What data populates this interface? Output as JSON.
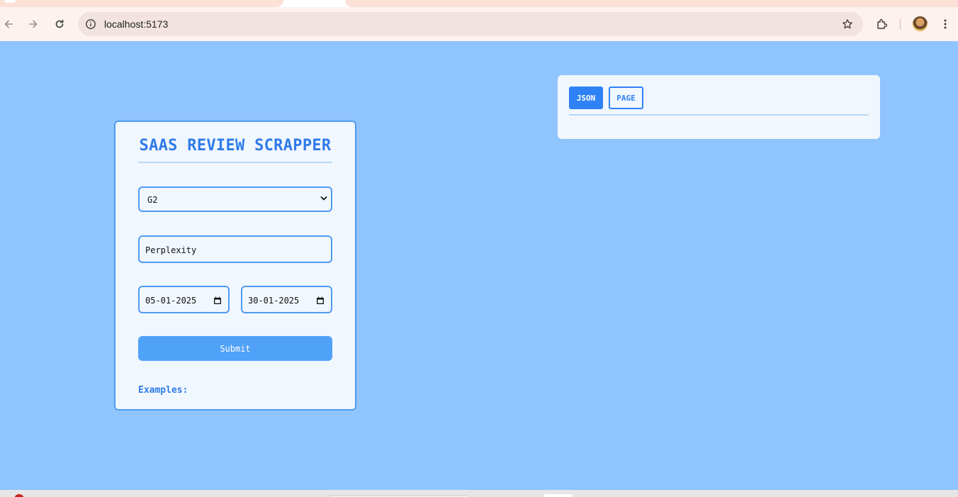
{
  "browser": {
    "url": "localhost:5173"
  },
  "form": {
    "title": "SAAS REVIEW SCRAPPER",
    "source_select": {
      "selected": "G2"
    },
    "company_input": {
      "value": "Perplexity"
    },
    "start_date": {
      "value": "05-01-2025"
    },
    "end_date": {
      "value": "30-01-2025"
    },
    "submit_label": "Submit",
    "examples_label": "Examples:"
  },
  "output": {
    "tabs": [
      {
        "label": "JSON",
        "active": true
      },
      {
        "label": "PAGE",
        "active": false
      }
    ]
  },
  "colors": {
    "background": "#90c4fd",
    "accent": "#2f7bea",
    "submit": "#50a1f8",
    "card": "#f1f7fe"
  }
}
